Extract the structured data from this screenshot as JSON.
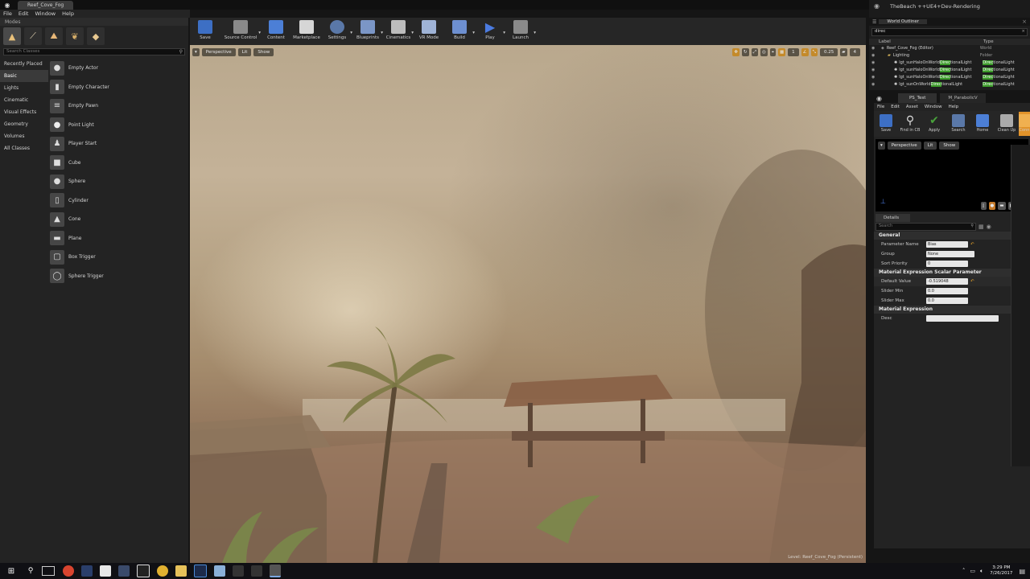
{
  "window": {
    "doc_tab": "Reef_Cove_Fog",
    "project_title": "TheBeach ++UE4+Dev-Rendering"
  },
  "menu": [
    "File",
    "Edit",
    "Window",
    "Help"
  ],
  "modes": {
    "title": "Modes",
    "search_placeholder": "Search Classes",
    "categories": [
      "Recently Placed",
      "Basic",
      "Lights",
      "Cinematic",
      "Visual Effects",
      "Geometry",
      "Volumes",
      "All Classes"
    ],
    "active_category": "Basic",
    "actors": [
      "Empty Actor",
      "Empty Character",
      "Empty Pawn",
      "Point Light",
      "Player Start",
      "Cube",
      "Sphere",
      "Cylinder",
      "Cone",
      "Plane",
      "Box Trigger",
      "Sphere Trigger"
    ]
  },
  "toolbar": {
    "buttons": [
      {
        "label": "Save",
        "color": "#3d6fc4"
      },
      {
        "label": "Source Control",
        "color": "#8a8a8a"
      },
      {
        "label": "Content",
        "color": "#4c7fd6"
      },
      {
        "label": "Marketplace",
        "color": "#d6d6d6"
      },
      {
        "label": "Settings",
        "color": "#5a78a8"
      },
      {
        "label": "Blueprints",
        "color": "#7b96c6"
      },
      {
        "label": "Cinematics",
        "color": "#bdbdbd"
      },
      {
        "label": "VR Mode",
        "color": "#9fb3d6"
      },
      {
        "label": "Build",
        "color": "#6d8fd0"
      },
      {
        "label": "Play",
        "color": "#4b7be0"
      },
      {
        "label": "Launch",
        "color": "#8a8a8a"
      }
    ]
  },
  "viewport": {
    "perspective": "Perspective",
    "lit": "Lit",
    "show": "Show",
    "snap_value": "0.25",
    "camera_speed": "4",
    "grid_value": "1",
    "status": "Level: Reef_Cove_Fog (Persistent)"
  },
  "outliner": {
    "tab": "World Outliner",
    "search": "direc",
    "col_label": "Label",
    "col_type": "Type",
    "rows": [
      {
        "label": "Reef_Cove_Fog (Editor)",
        "type": "World"
      },
      {
        "label": "Lighting",
        "type": "Folder"
      },
      {
        "label_pre": "lgt_sunHaloOnWorld",
        "label_hl": "Direc",
        "label_post": "tionalLight",
        "type_hl": "Direc",
        "type_post": "tionalLight"
      },
      {
        "label_pre": "lgt_sunHaloOnWorld",
        "label_hl": "Direc",
        "label_post": "tionalLight",
        "type_hl": "Direc",
        "type_post": "tionalLight"
      },
      {
        "label_pre": "lgt_sunHaloOnWorld",
        "label_hl": "Direc",
        "label_post": "tionalLight",
        "type_hl": "Direc",
        "type_post": "tionalLight"
      },
      {
        "label_pre": "lgt_sunOnWorld",
        "label_hl": "Direc",
        "label_post": "tionalLight",
        "type_hl": "Direc",
        "type_post": "tionalLight"
      }
    ]
  },
  "material_editor": {
    "tab1": "PS_Test",
    "tab2": "M_ParabolicV",
    "menu": [
      "File",
      "Edit",
      "Asset",
      "Window",
      "Help"
    ],
    "buttons": [
      {
        "label": "Save",
        "color": "#3d6fc4"
      },
      {
        "label": "Find in CB",
        "color": "#9a9a9a"
      },
      {
        "label": "Apply",
        "color": "#49a23b"
      },
      {
        "label": "Search",
        "color": "#5a78a8"
      },
      {
        "label": "Home",
        "color": "#4c7fd6"
      },
      {
        "label": "Clean Up",
        "color": "#aaaaaa"
      },
      {
        "label": "Conn",
        "color": "#e2932a"
      }
    ],
    "preview": {
      "perspective": "Perspective",
      "lit": "Lit",
      "show": "Show"
    },
    "details_tab": "Details",
    "search_placeholder": "Search",
    "sections": {
      "general": "General",
      "scalar": "Material Expression Scalar Parameter",
      "expression": "Material Expression"
    },
    "props": {
      "parameter_name_label": "Parameter Name",
      "parameter_name": "Bias",
      "group_label": "Group",
      "group": "None",
      "sort_priority_label": "Sort Priority",
      "sort_priority": "0",
      "default_value_label": "Default Value",
      "default_value": "-0.519048",
      "slider_min_label": "Slider Min",
      "slider_min": "0.0",
      "slider_max_label": "Slider Max",
      "slider_max": "0.0",
      "desc_label": "Desc",
      "desc": ""
    }
  },
  "taskbar": {
    "time": "3:29 PM",
    "date": "7/26/2017"
  }
}
